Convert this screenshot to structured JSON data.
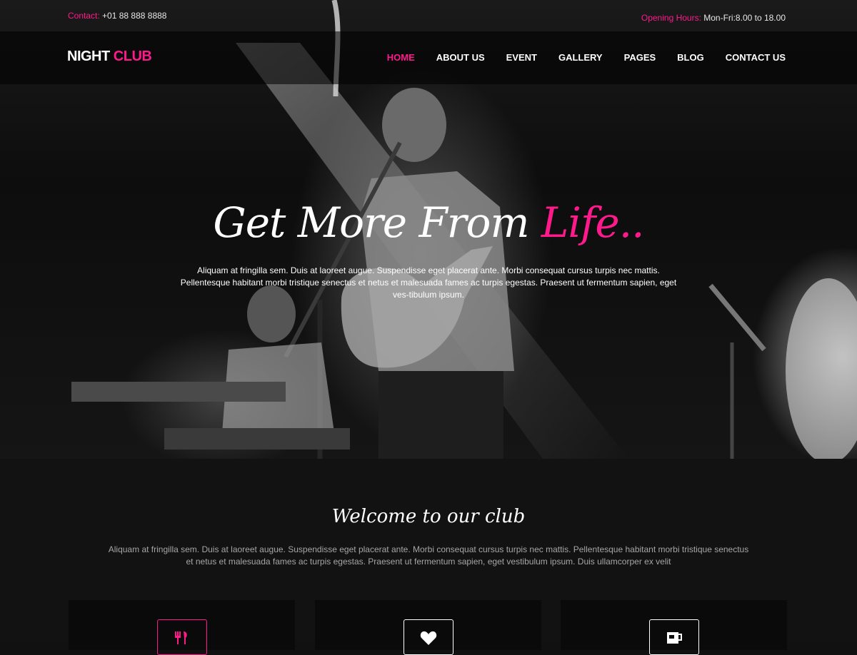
{
  "topbar": {
    "contact_label": "Contact:",
    "contact_value": "+01 88 888 8888",
    "hours_label": "Opening Hours:",
    "hours_value": "Mon-Fri:8.00 to 18.00"
  },
  "brand": {
    "part1": "NIGHT",
    "part2": "CLUB"
  },
  "nav": {
    "items": [
      "HOME",
      "ABOUT US",
      "EVENT",
      "GALLERY",
      "PAGES",
      "BLOG",
      "CONTACT US"
    ],
    "active": "HOME"
  },
  "hero": {
    "title_main": "Get More From",
    "title_accent": "Life..",
    "text": "Aliquam at fringilla sem. Duis at laoreet augue. Suspendisse eget placerat ante. Morbi consequat cursus turpis nec mattis. Pellentesque habitant morbi tristique senectus et netus et malesuada fames ac turpis egestas. Praesent ut fermentum sapien, eget ves-tibulum ipsum."
  },
  "welcome": {
    "title": "Welcome to our club",
    "text": "Aliquam at fringilla sem. Duis at laoreet augue. Suspendisse eget placerat ante. Morbi consequat cursus turpis nec mattis. Pellentesque habitant morbi tristique senectus et netus et malesuada fames ac turpis egestas. Praesent ut fermentum sapien, eget vestibulum ipsum. Duis ullamcorper ex velit"
  },
  "cards": [
    {
      "icon": "cutlery-icon"
    },
    {
      "icon": "heart-icon"
    },
    {
      "icon": "cup-icon"
    }
  ],
  "colors": {
    "accent": "#ff1a8c",
    "background": "#111111"
  }
}
